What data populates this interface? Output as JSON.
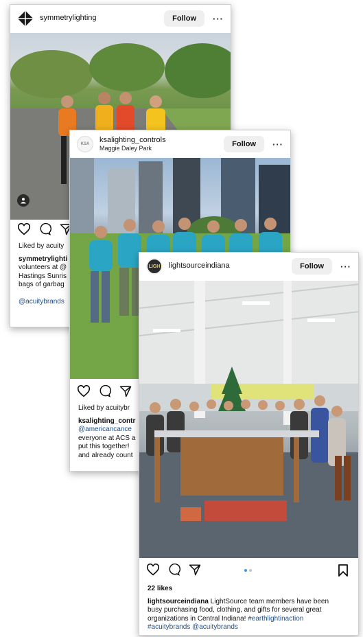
{
  "colors": {
    "link": "#1c4e8a",
    "dot_active": "#3897f0",
    "dot_inactive": "#c4c4c4"
  },
  "posts": [
    {
      "handle": "symmetrylighting",
      "avatar_icon": "symmetry-diamond-logo",
      "follow_label": "Follow",
      "more_label": "···",
      "photo_badge_icon": "user-tag-icon",
      "liked_by": "Liked by acuity",
      "caption_line1_user": "symmetrylighti",
      "caption_line2": "volunteers at @",
      "caption_line3": "Hastings Sunris",
      "caption_line4": "bags of garbag",
      "caption_tag": "@acuitybrands"
    },
    {
      "handle": "ksalighting_controls",
      "location": "Maggie Daley Park",
      "avatar_text": "KSA",
      "follow_label": "Follow",
      "more_label": "···",
      "liked_by": "Liked by acuitybr",
      "caption_line1_user": "ksalighting_contr",
      "caption_line2": "@americancance",
      "caption_line3": "everyone at ACS a",
      "caption_line4": "put this together!",
      "caption_line5": "and already count"
    },
    {
      "handle": "lightsourceindiana",
      "avatar_text": "LIGH",
      "follow_label": "Follow",
      "more_label": "···",
      "likes": "22 likes",
      "caption_user": "lightsourceindiana",
      "caption_text1": " LightSource team members have been",
      "caption_text2": "busy purchasing food, clothing, and gifts for several great",
      "caption_text3": "organizations in Central Indiana! ",
      "caption_hashtag1": "#earthlightinaction",
      "caption_hashtag2": "#acuitybrands",
      "caption_mention": "@acuitybrands"
    }
  ]
}
